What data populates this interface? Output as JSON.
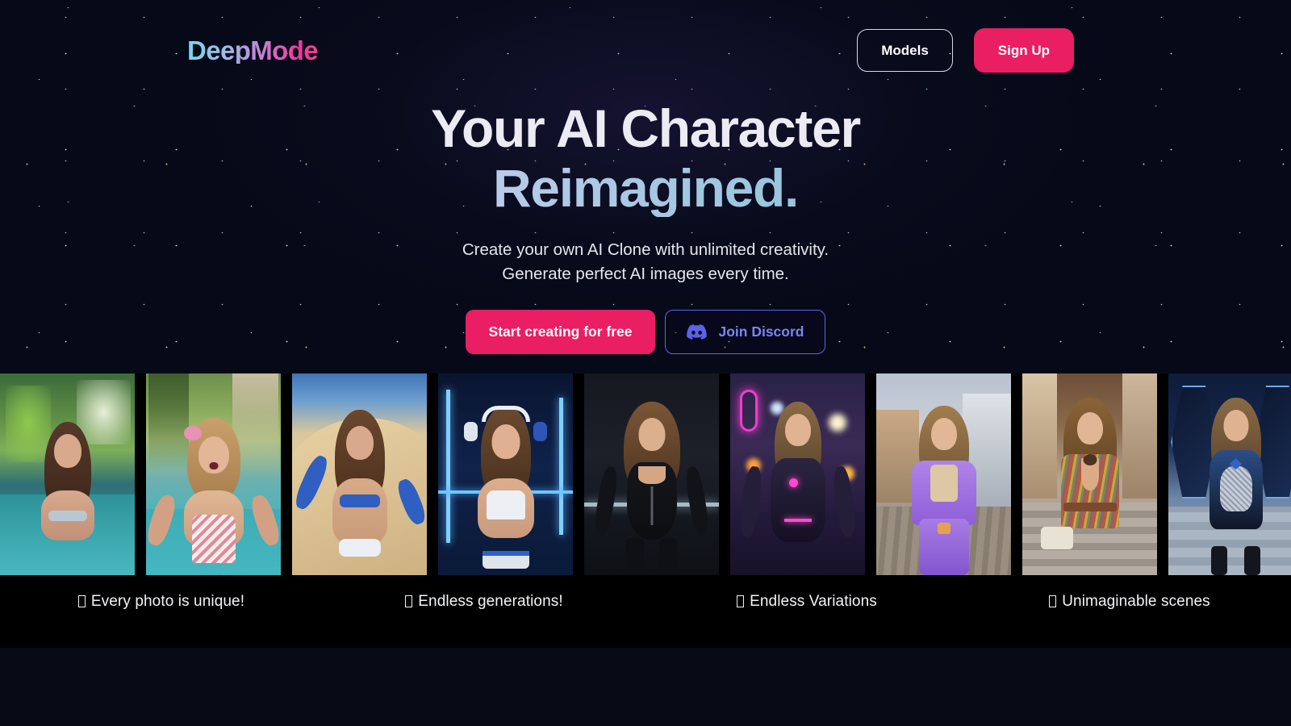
{
  "brand": {
    "logo_text": "DeepMode",
    "accent_pink": "#e91e63",
    "accent_blue": "#5865f2",
    "gradient_start": "#79d8e8",
    "gradient_end": "#f43f95"
  },
  "nav": {
    "models_label": "Models",
    "signup_label": "Sign Up"
  },
  "hero": {
    "headline_line1": "Your AI Character",
    "headline_line2": "Reimagined.",
    "subline_line1": "Create your own AI Clone with unlimited creativity.",
    "subline_line2": "Generate perfect AI images every time.",
    "primary_cta": "Start creating for free",
    "secondary_cta": "Join Discord",
    "discord_icon": "discord-icon"
  },
  "gallery": {
    "tiles": [
      {
        "alt": "woman in pool with tropical greenery"
      },
      {
        "alt": "blonde woman selfie by poolside palms"
      },
      {
        "alt": "woman peace sign on sand dune in blue sportswear"
      },
      {
        "alt": "woman with white headphones in neon gym"
      },
      {
        "alt": "woman in black latex bodysuit on dark runway"
      },
      {
        "alt": "woman in cyberpunk armor on neon city street"
      },
      {
        "alt": "woman in purple puffer jacket on town street"
      },
      {
        "alt": "woman in striped blazer with handbag outdoors"
      },
      {
        "alt": "woman in blue armored dress in hexagon corridor"
      }
    ],
    "captions": [
      {
        "icon": "emoji-tofu",
        "text": "Every photo is unique!"
      },
      {
        "icon": "emoji-tofu",
        "text": "Endless generations!"
      },
      {
        "icon": "emoji-tofu",
        "text": "Endless Variations"
      },
      {
        "icon": "emoji-tofu",
        "text": "Unimaginable scenes"
      }
    ]
  }
}
